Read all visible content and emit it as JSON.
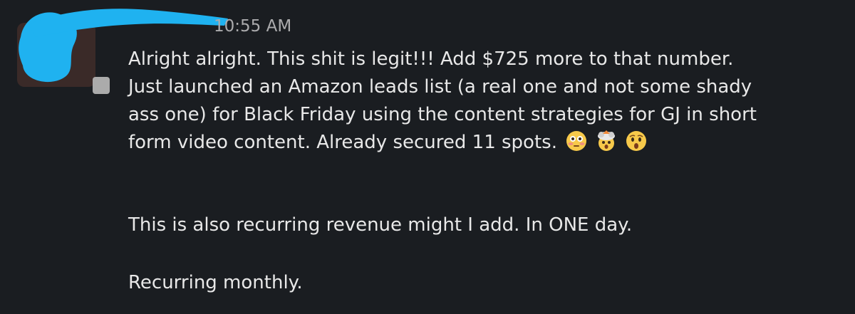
{
  "message": {
    "timestamp": "10:55 AM",
    "paragraph1_lines": [
      "Alright alright. This shit is legit!!! Add $725 more to that number.",
      "Just launched an Amazon leads list (a real one and not some shady",
      "ass one) for Black Friday using the content strategies for GJ in short",
      "form video content. Already secured 11 spots."
    ],
    "paragraph2": "This is also recurring revenue might I add. In ONE day.",
    "paragraph3": "Recurring monthly.",
    "emojis": [
      "flushed-face",
      "exploding-head",
      "astonished-face"
    ]
  },
  "colors": {
    "background": "#1a1d21",
    "text": "#e8e8e8",
    "timestamp": "#ababad",
    "redaction": "#1fb2f0",
    "checkbox": "#ababab"
  }
}
